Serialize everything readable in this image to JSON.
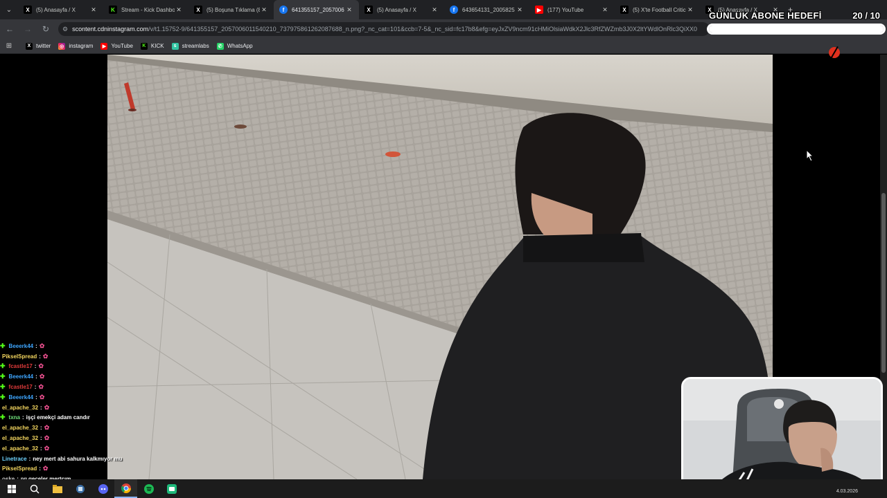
{
  "tabs": [
    {
      "title": "(5) Anasayfa / X",
      "icon": "x-icon",
      "favicon": "X",
      "active": false
    },
    {
      "title": "Stream - Kick Dashbo",
      "icon": "kick-icon",
      "favicon": "K",
      "active": false
    },
    {
      "title": "(5) Boşuna Tıklama (8",
      "icon": "x-icon",
      "favicon": "X",
      "active": false
    },
    {
      "title": "641355157_2057006",
      "icon": "facebook-icon",
      "favicon": "f",
      "active": true
    },
    {
      "title": "(5) Anasayfa / X",
      "icon": "x-icon",
      "favicon": "X",
      "active": false
    },
    {
      "title": "643654131_2005825",
      "icon": "facebook-icon",
      "favicon": "f",
      "active": false
    },
    {
      "title": "(177) YouTube",
      "icon": "youtube-icon",
      "favicon": "▶",
      "active": false
    },
    {
      "title": "(5) X'te Football Critic",
      "icon": "x-icon",
      "favicon": "X",
      "active": false
    },
    {
      "title": "(5) Anasayfa / X",
      "icon": "x-icon",
      "favicon": "X",
      "active": false
    }
  ],
  "address": {
    "host": "scontent.cdninstagram.com",
    "path": "/v/t1.15752-9/641355157_2057006011540210_737975861262087688_n.png?_nc_cat=101&ccb=7-5&_nc_sid=fc17b8&efg=eyJxZV9ncm91cHMiOlsiaWdkX2Jlc3RfZWZmb3J0X2ltYWdlOnRlc3QiXX0"
  },
  "bookmarks": [
    {
      "label": "twitter",
      "icon": "x-icon",
      "glyph": "X"
    },
    {
      "label": "instagram",
      "icon": "instagram-icon",
      "glyph": "◎"
    },
    {
      "label": "YouTube",
      "icon": "youtube-icon",
      "glyph": "▶"
    },
    {
      "label": "KICK",
      "icon": "kick-icon",
      "glyph": "K"
    },
    {
      "label": "streamlabs",
      "icon": "streamlabs-icon",
      "glyph": "s"
    },
    {
      "label": "WhatsApp",
      "icon": "whatsapp-icon",
      "glyph": "✆"
    }
  ],
  "goal": {
    "title": "GÜNLÜK ABONE HEDEFİ",
    "current": "20",
    "target": "/ 10",
    "progress": 1.0
  },
  "chat": [
    {
      "user": "Beeerk44",
      "color": "#3ea6ff",
      "badge": true,
      "message": "",
      "emote": true
    },
    {
      "user": "PikselSpread",
      "color": "#f6d860",
      "badge": false,
      "message": "",
      "emote": true
    },
    {
      "user": "fcastle17",
      "color": "#e23b3b",
      "badge": true,
      "message": "",
      "emote": true
    },
    {
      "user": "Beeerk44",
      "color": "#3ea6ff",
      "badge": true,
      "message": "",
      "emote": true
    },
    {
      "user": "fcastle17",
      "color": "#e23b3b",
      "badge": true,
      "message": "",
      "emote": true
    },
    {
      "user": "Beeerk44",
      "color": "#3ea6ff",
      "badge": true,
      "message": "",
      "emote": true
    },
    {
      "user": "el_apache_32",
      "color": "#f6d860",
      "badge": false,
      "message": "",
      "emote": true
    },
    {
      "user": "txna",
      "color": "#6fe07a",
      "badge": true,
      "message": "işçi emekçi adam candır",
      "emote": false
    },
    {
      "user": "el_apache_32",
      "color": "#f6d860",
      "badge": false,
      "message": "",
      "emote": true
    },
    {
      "user": "el_apache_32",
      "color": "#f6d860",
      "badge": false,
      "message": "",
      "emote": true
    },
    {
      "user": "el_apache_32",
      "color": "#f6d860",
      "badge": false,
      "message": "",
      "emote": true
    },
    {
      "user": "Linetrace",
      "color": "#6fd4ff",
      "badge": false,
      "message": "ney mert abi sahura kalkmıyor mu",
      "emote": false
    },
    {
      "user": "PikselSpread",
      "color": "#f6d860",
      "badge": false,
      "message": "",
      "emote": true
    },
    {
      "user": "oske",
      "color": "#cccccc",
      "badge": false,
      "message": "ıyı geceler mertcım",
      "emote": false
    }
  ],
  "taskbar": {
    "apps": [
      "windows-start-icon",
      "search-icon",
      "file-explorer-icon",
      "snipping-icon",
      "discord-icon",
      "chrome-icon",
      "spotify-icon",
      "obs-icon"
    ],
    "date": "4.03.2026"
  },
  "colors": {
    "accent_kick": "#53fc18",
    "tab_bg": "#202124",
    "toolbar_bg": "#35363a",
    "emote": "#e44d8a"
  }
}
